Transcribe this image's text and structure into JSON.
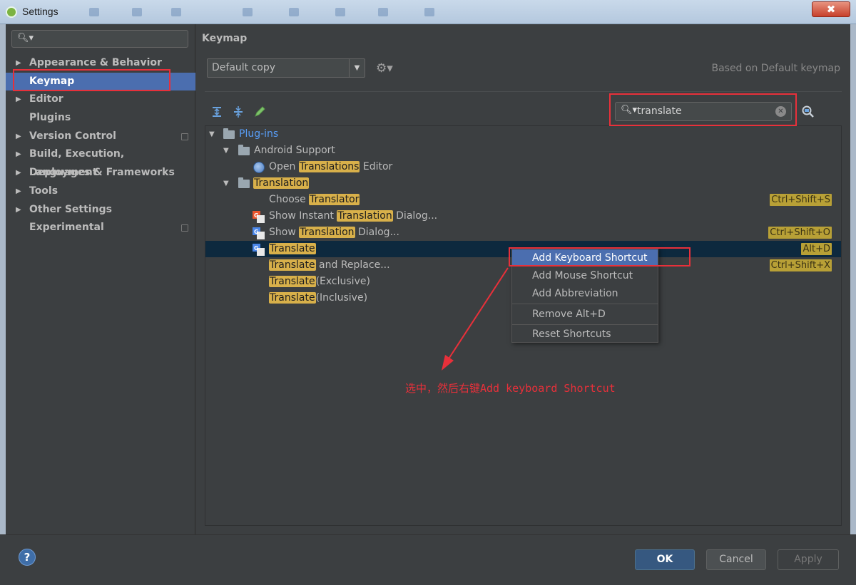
{
  "window": {
    "title": "Settings",
    "close_label": "✖"
  },
  "sidebar": {
    "search_placeholder": "",
    "items": [
      {
        "label": "Appearance & Behavior",
        "expandable": true
      },
      {
        "label": "Keymap",
        "expandable": false,
        "selected": true
      },
      {
        "label": "Editor",
        "expandable": true
      },
      {
        "label": "Plugins",
        "expandable": false
      },
      {
        "label": "Version Control",
        "expandable": true
      },
      {
        "label": "Build, Execution, Deployment",
        "expandable": true
      },
      {
        "label": "Languages & Frameworks",
        "expandable": true
      },
      {
        "label": "Tools",
        "expandable": true
      },
      {
        "label": "Other Settings",
        "expandable": true
      },
      {
        "label": "Experimental",
        "expandable": false
      }
    ]
  },
  "main": {
    "section_title": "Keymap",
    "keymap_value": "Default copy",
    "based_on": "Based on Default keymap",
    "search_value": "translate",
    "tree": {
      "plugins": "Plug-ins",
      "android_support": "Android Support",
      "open_pre": "Open ",
      "open_hl": "Translations",
      "open_post": " Editor",
      "translation_folder": "Translation",
      "choose_pre": "Choose ",
      "choose_hl": "Translator",
      "choose_shortcut": "Ctrl+Shift+S",
      "instant_pre": "Show Instant ",
      "instant_hl": "Translation",
      "instant_post": " Dialog...",
      "show_pre": "Show ",
      "show_hl": "Translation",
      "show_post": " Dialog...",
      "show_shortcut": "Ctrl+Shift+O",
      "translate_hl": "Translate",
      "translate_shortcut": "Alt+D",
      "replace_hl": "Translate",
      "replace_post": " and Replace...",
      "replace_shortcut": "Ctrl+Shift+X",
      "exclusive_hl": "Translate",
      "exclusive_post": "(Exclusive)",
      "inclusive_hl": "Translate",
      "inclusive_post": "(Inclusive)"
    }
  },
  "context_menu": {
    "items": [
      "Add Keyboard Shortcut",
      "Add Mouse Shortcut",
      "Add Abbreviation",
      "Remove Alt+D",
      "Reset Shortcuts"
    ]
  },
  "annotation": "选中，然后右键Add keyboard Shortcut",
  "buttons": {
    "ok": "OK",
    "cancel": "Cancel",
    "apply": "Apply",
    "help": "?"
  },
  "colors": {
    "accent": "#4b6eaf",
    "highlight": "#d8b04a",
    "annotation": "#e8303a",
    "link": "#589df6"
  }
}
